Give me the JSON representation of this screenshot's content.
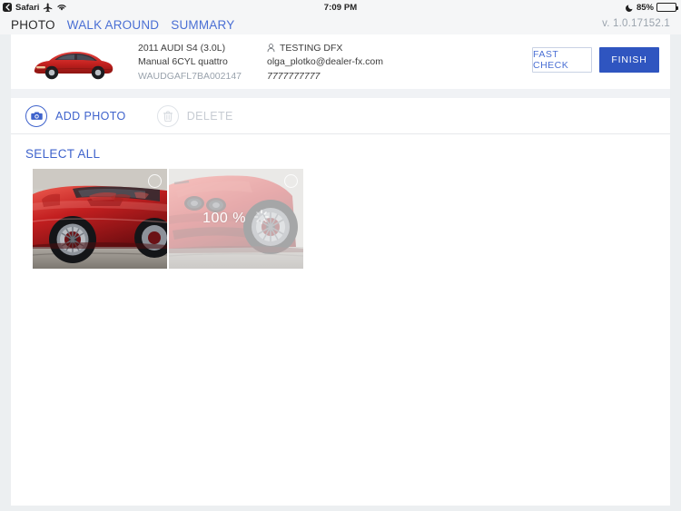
{
  "statusbar": {
    "back_app": "Safari",
    "back_icon": "back-chevron-icon",
    "airplane_icon": "airplane-mode-icon",
    "wifi_icon": "wifi-icon",
    "time": "7:09 PM",
    "dnd_icon": "do-not-disturb-moon-icon",
    "battery_percent": "85%",
    "battery_level": 85
  },
  "topnav": {
    "items": [
      {
        "label": "PHOTO",
        "active": true
      },
      {
        "label": "WALK AROUND",
        "active": false
      },
      {
        "label": "SUMMARY",
        "active": false
      }
    ],
    "version": "v. 1.0.17152.1"
  },
  "vehicle": {
    "thumbnail_icon": "red-audi-sedan-thumbnail",
    "title": "2011 AUDI S4 (3.0L)",
    "spec": "Manual 6CYL quattro",
    "vin": "WAUDGAFL7BA002147",
    "customer_icon": "person-icon",
    "customer_name": "TESTING DFX",
    "customer_email": "olga_plotko@dealer-fx.com",
    "customer_phone": "7777777777"
  },
  "card_actions": {
    "fast_check_label": "FAST CHECK",
    "finish_label": "FINISH"
  },
  "toolbar": {
    "add_photo_label": "ADD PHOTO",
    "add_photo_icon": "camera-icon",
    "delete_label": "DELETE",
    "delete_icon": "trash-icon",
    "delete_disabled": true
  },
  "gallery": {
    "select_all_label": "SELECT ALL",
    "photos": [
      {
        "alt": "red-sports-car-side-view",
        "selected": false,
        "uploading": false,
        "progress_label": ""
      },
      {
        "alt": "red-sports-car-front-quarter",
        "selected": false,
        "uploading": true,
        "progress_label": "100 %"
      }
    ]
  },
  "colors": {
    "accent_blue": "#3f63cc",
    "primary_button": "#2f55c0",
    "page_background": "#eceff1",
    "muted_text": "#9aa3ad"
  }
}
